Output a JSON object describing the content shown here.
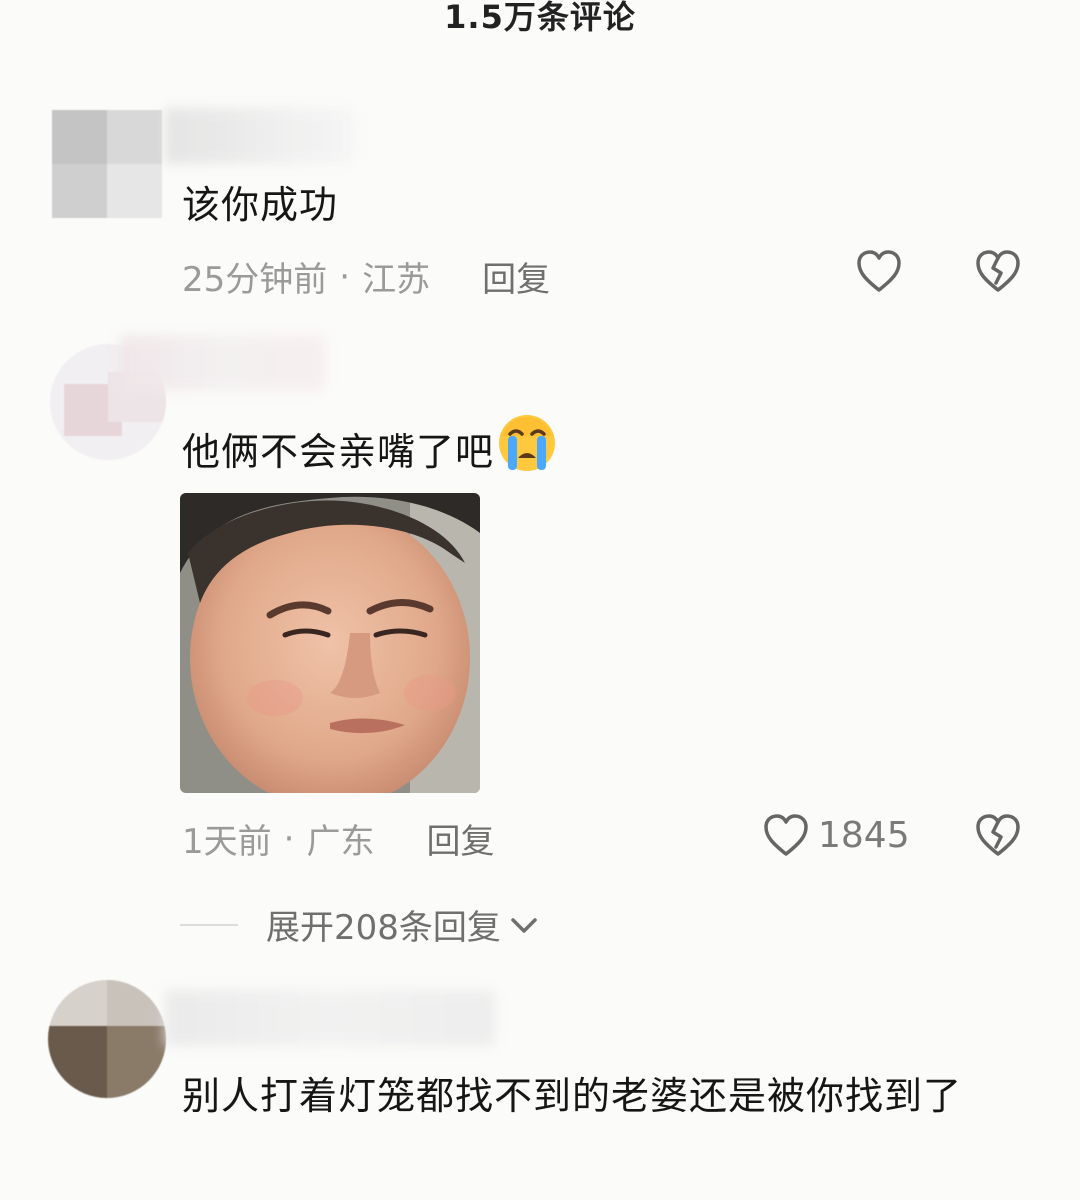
{
  "header": {
    "title": "1.5万条评论"
  },
  "comments": [
    {
      "text": "该你成功",
      "time": "25分钟前",
      "location": "江苏",
      "reply_label": "回复",
      "likes": ""
    },
    {
      "text": "他俩不会亲嘴了吧",
      "emoji": "😭",
      "time": "1天前",
      "location": "广东",
      "reply_label": "回复",
      "likes": "1845",
      "expand_label": "展开208条回复"
    },
    {
      "text": "别人打着灯笼都找不到的老婆还是被你找到了"
    }
  ],
  "icons": {
    "like": "heart-outline-icon",
    "dislike": "broken-heart-icon",
    "expand": "chevron-down-icon",
    "emoji": "crying-face-emoji"
  },
  "colors": {
    "background": "#fbfbf9",
    "meta_text": "#9a9a9a",
    "reply_text": "#6f6f6f",
    "body_text": "#161616"
  }
}
